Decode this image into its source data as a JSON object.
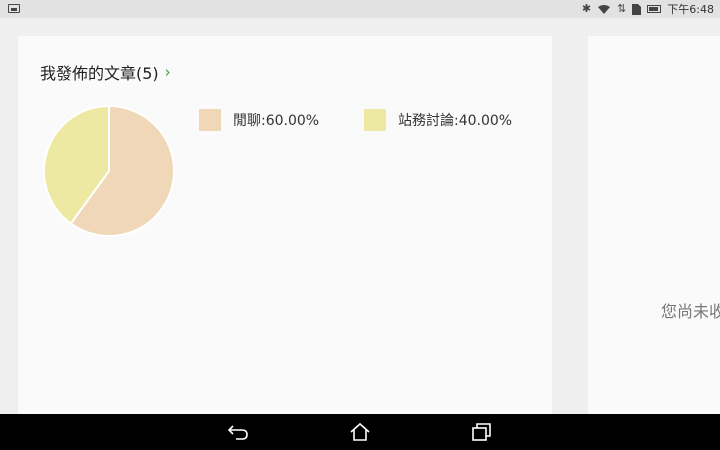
{
  "status_bar": {
    "time": "下午6:48",
    "icons": [
      "image-icon",
      "bluetooth-icon",
      "wifi-icon",
      "sim-icon",
      "battery-icon"
    ]
  },
  "posts_card": {
    "title": "我發佈的文章(5)",
    "chevron": "›"
  },
  "chart_data": {
    "type": "pie",
    "title": "",
    "slices": [
      {
        "label": "閒聊",
        "value": 60.0,
        "color": "#efd7b8"
      },
      {
        "label": "站務討論",
        "value": 40.0,
        "color": "#ede8a2"
      }
    ],
    "legend_labels": [
      "閒聊:60.00%",
      "站務討論:40.00%"
    ],
    "legend_position": "right"
  },
  "right_card": {
    "empty_text": "您尚未收"
  },
  "nav_bar": {
    "icons": [
      "back-icon",
      "home-icon",
      "recent-apps-icon"
    ]
  }
}
